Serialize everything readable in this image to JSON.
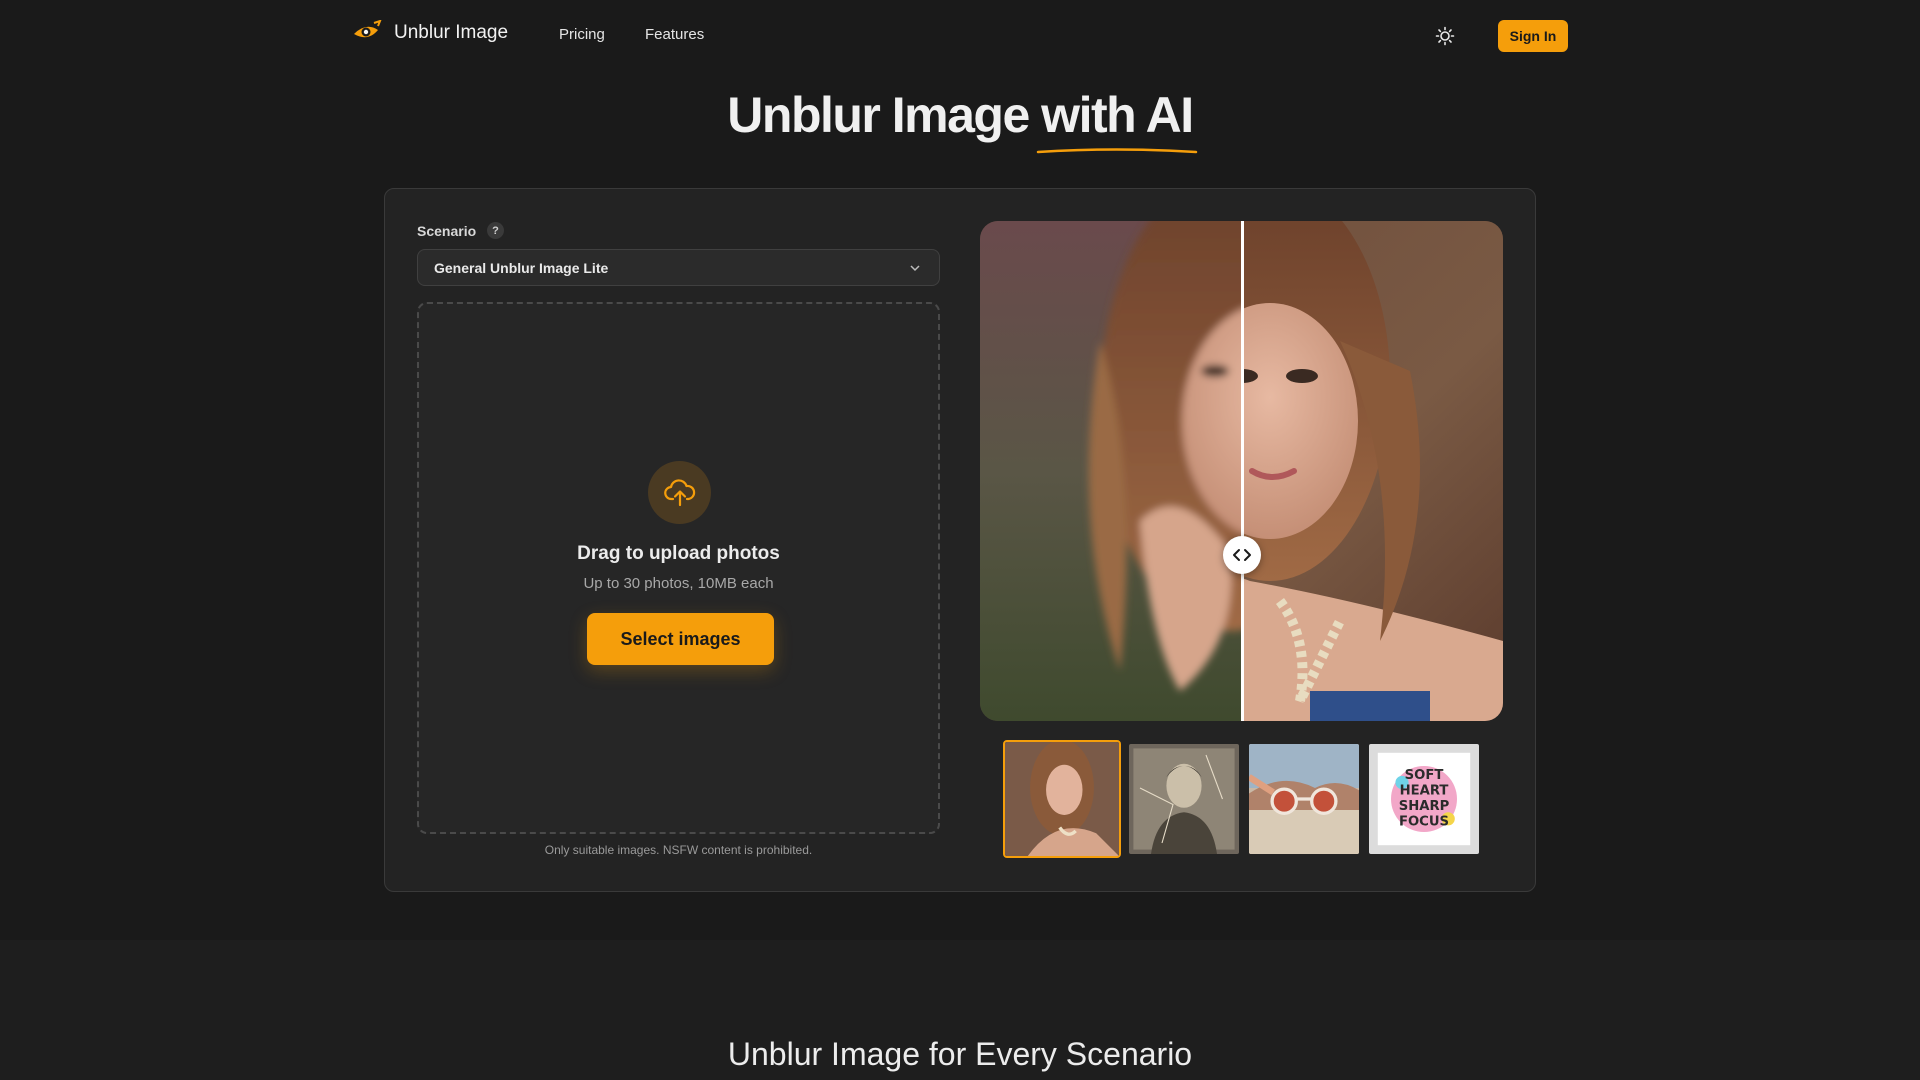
{
  "nav": {
    "brand": "Unblur Image",
    "links": [
      "Pricing",
      "Features"
    ],
    "sign_in": "Sign In",
    "theme_icon": "sun-icon",
    "logo_icon": "logo-eye-icon"
  },
  "hero": {
    "title_main": "Unblur Image ",
    "title_accent": "with AI"
  },
  "tool": {
    "scenario_label": "Scenario",
    "help": "?",
    "scenario_value": "General Unblur Image Lite",
    "upload_title": "Drag to upload photos",
    "upload_subtitle": "Up to 30 photos, 10MB each",
    "select_button": "Select images",
    "nsfw_note": "Only suitable images. NSFW content is prohibited.",
    "upload_icon": "cloud-upload-icon",
    "chevron_icon": "chevron-down-icon"
  },
  "samples": {
    "sticker_text": [
      "SOFT",
      "HEART",
      "SHARP",
      "FOCUS"
    ]
  },
  "section": {
    "title": "Unblur Image for Every Scenario"
  },
  "colors": {
    "accent": "#f59e0b",
    "background": "#1a1a1a",
    "card": "#232323"
  }
}
